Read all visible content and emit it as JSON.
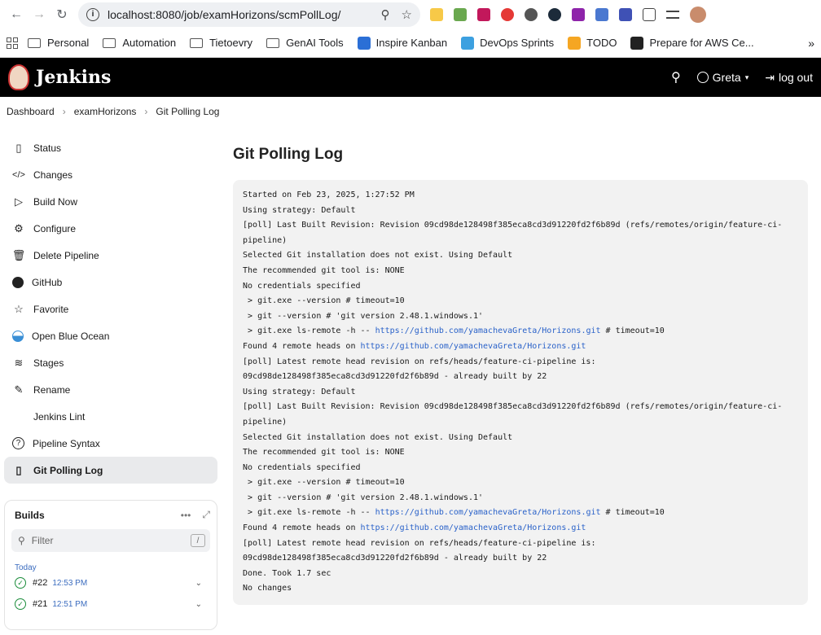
{
  "browser": {
    "url": "localhost:8080/job/examHorizons/scmPollLog/",
    "bookmarks": [
      "Personal",
      "Automation",
      "Tietoevry",
      "GenAI Tools",
      "Inspire Kanban",
      "DevOps Sprints",
      "TODO",
      "Prepare for AWS Ce..."
    ]
  },
  "header": {
    "title": "Jenkins",
    "user": "Greta",
    "logout": "log out"
  },
  "breadcrumb": [
    "Dashboard",
    "examHorizons",
    "Git Polling Log"
  ],
  "sidebar": {
    "items": [
      {
        "label": "Status",
        "icon": "document-icon"
      },
      {
        "label": "Changes",
        "icon": "code-icon"
      },
      {
        "label": "Build Now",
        "icon": "play-icon"
      },
      {
        "label": "Configure",
        "icon": "gear-icon"
      },
      {
        "label": "Delete Pipeline",
        "icon": "trash-icon"
      },
      {
        "label": "GitHub",
        "icon": "github-icon"
      },
      {
        "label": "Favorite",
        "icon": "star-icon"
      },
      {
        "label": "Open Blue Ocean",
        "icon": "blue-ocean-icon"
      },
      {
        "label": "Stages",
        "icon": "layers-icon"
      },
      {
        "label": "Rename",
        "icon": "pencil-icon"
      },
      {
        "label": "Jenkins Lint",
        "icon": ""
      },
      {
        "label": "Pipeline Syntax",
        "icon": "help-icon"
      },
      {
        "label": "Git Polling Log",
        "icon": "clipboard-icon"
      }
    ]
  },
  "builds": {
    "title": "Builds",
    "filter_placeholder": "Filter",
    "filter_shortcut": "/",
    "group": "Today",
    "items": [
      {
        "number": "#22",
        "time": "12:53 PM"
      },
      {
        "number": "#21",
        "time": "12:51 PM"
      }
    ]
  },
  "page": {
    "title": "Git Polling Log",
    "log": [
      [
        "Started on Feb 23, 2025, 1:27:52 PM"
      ],
      [
        "Using strategy: Default"
      ],
      [
        "[poll] Last Built Revision: Revision 09cd98de128498f385eca8cd3d91220fd2f6b89d (refs/remotes/origin/feature-ci-pipeline)"
      ],
      [
        "Selected Git installation does not exist. Using Default"
      ],
      [
        "The recommended git tool is: NONE"
      ],
      [
        "No credentials specified"
      ],
      [
        " > git.exe --version # timeout=10"
      ],
      [
        " > git --version # 'git version 2.48.1.windows.1'"
      ],
      [
        " > git.exe ls-remote -h -- ",
        "https://github.com/yamachevaGreta/Horizons.git",
        " # timeout=10"
      ],
      [
        "Found 4 remote heads on ",
        "https://github.com/yamachevaGreta/Horizons.git",
        ""
      ],
      [
        "[poll] Latest remote head revision on refs/heads/feature-ci-pipeline is:"
      ],
      [
        "09cd98de128498f385eca8cd3d91220fd2f6b89d - already built by 22"
      ],
      [
        "Using strategy: Default"
      ],
      [
        "[poll] Last Built Revision: Revision 09cd98de128498f385eca8cd3d91220fd2f6b89d (refs/remotes/origin/feature-ci-pipeline)"
      ],
      [
        "Selected Git installation does not exist. Using Default"
      ],
      [
        "The recommended git tool is: NONE"
      ],
      [
        "No credentials specified"
      ],
      [
        " > git.exe --version # timeout=10"
      ],
      [
        " > git --version # 'git version 2.48.1.windows.1'"
      ],
      [
        " > git.exe ls-remote -h -- ",
        "https://github.com/yamachevaGreta/Horizons.git",
        " # timeout=10"
      ],
      [
        "Found 4 remote heads on ",
        "https://github.com/yamachevaGreta/Horizons.git",
        ""
      ],
      [
        "[poll] Latest remote head revision on refs/heads/feature-ci-pipeline is:"
      ],
      [
        "09cd98de128498f385eca8cd3d91220fd2f6b89d - already built by 22"
      ],
      [
        "Done. Took 1.7 sec"
      ],
      [
        "No changes"
      ]
    ]
  }
}
